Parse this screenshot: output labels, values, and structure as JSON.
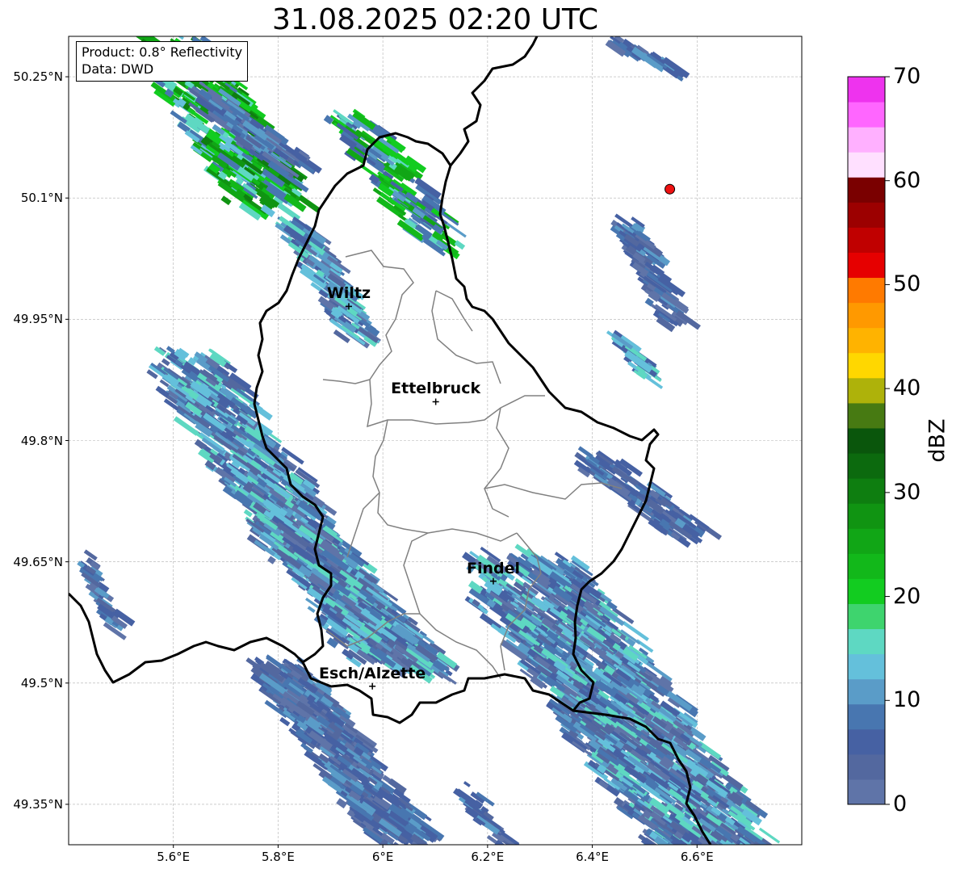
{
  "title": "31.08.2025 02:20 UTC",
  "info_box": {
    "product": "Product: 0.8° Reflectivity",
    "data": "Data: DWD"
  },
  "lat_labels": [
    "50.25°N",
    "50.1°N",
    "49.95°N",
    "49.8°N",
    "49.65°N",
    "49.5°N",
    "49.35°N"
  ],
  "lon_labels": [
    "5.6°E",
    "5.8°E",
    "6°E",
    "6.2°E",
    "6.4°E",
    "6.6°E"
  ],
  "cities": [
    {
      "name": "Wiltz",
      "lon": 5.935,
      "lat": 49.966
    },
    {
      "name": "Ettelbruck",
      "lon": 6.101,
      "lat": 49.848
    },
    {
      "name": "Findel",
      "lon": 6.211,
      "lat": 49.626
    },
    {
      "name": "Esch/Alzette",
      "lon": 5.98,
      "lat": 49.496
    }
  ],
  "map_extent": {
    "lon_min": 5.4,
    "lon_max": 6.8,
    "lat_min": 49.3,
    "lat_max": 50.3
  },
  "radar_site_marker": {
    "lon": 6.548,
    "lat": 50.111,
    "color": "#ee1111"
  },
  "colorbar": {
    "label": "dBZ",
    "ticks": [
      "0",
      "10",
      "20",
      "30",
      "40",
      "50",
      "60",
      "70"
    ],
    "range": [
      0,
      70
    ],
    "colors": [
      "#5f74a8",
      "#53689f",
      "#4661a3",
      "#4876b0",
      "#5a9cc8",
      "#64c0db",
      "#5ed8c2",
      "#3ed46e",
      "#12cc20",
      "#12b81a",
      "#11a616",
      "#109412",
      "#0e7e10",
      "#0c6a0e",
      "#0a560c",
      "#477a12",
      "#aeb20a",
      "#ffd700",
      "#ffb300",
      "#ff9900",
      "#ff7a00",
      "#e60000",
      "#c00000",
      "#9c0000",
      "#7a0000",
      "#ffe0ff",
      "#ffb0ff",
      "#ff66ff",
      "#ee33ee"
    ]
  }
}
